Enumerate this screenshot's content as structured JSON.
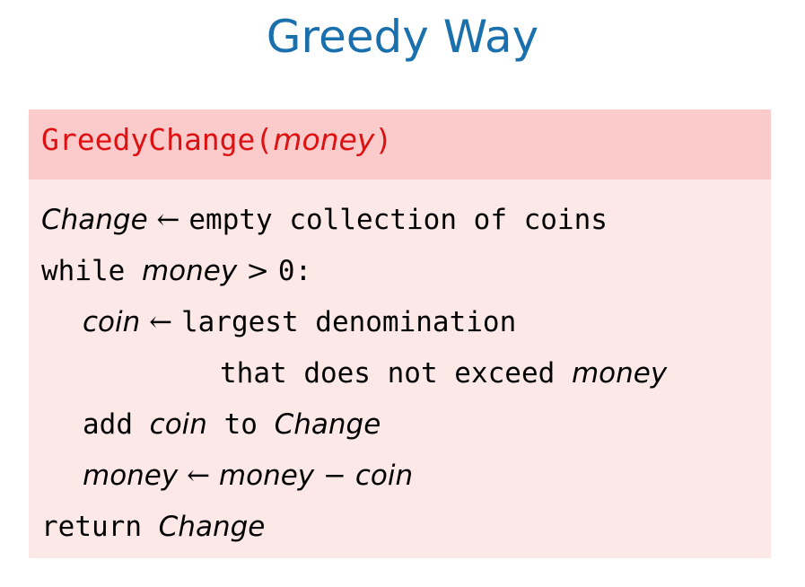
{
  "slide": {
    "title": "Greedy Way"
  },
  "algorithm": {
    "function_name": "GreedyChange",
    "open_paren": "(",
    "parameter": "money",
    "close_paren": ")",
    "lines": [
      {
        "v1": "Change",
        "arrow": " ← ",
        "text": "empty collection of coins"
      },
      {
        "kw": "while ",
        "v1": "money",
        "op": " > ",
        "num": "0:"
      },
      {
        "v1": "coin",
        "arrow": " ← ",
        "text": "largest denomination"
      },
      {
        "text": "that does not exceed ",
        "v1": "money"
      },
      {
        "kw": "add ",
        "v1": "coin",
        "mid": " to ",
        "v2": "Change"
      },
      {
        "v1": "money",
        "arrow": " ← ",
        "v2": "money",
        "op": " − ",
        "v3": "coin"
      },
      {
        "kw": "return ",
        "v1": "Change"
      }
    ]
  }
}
